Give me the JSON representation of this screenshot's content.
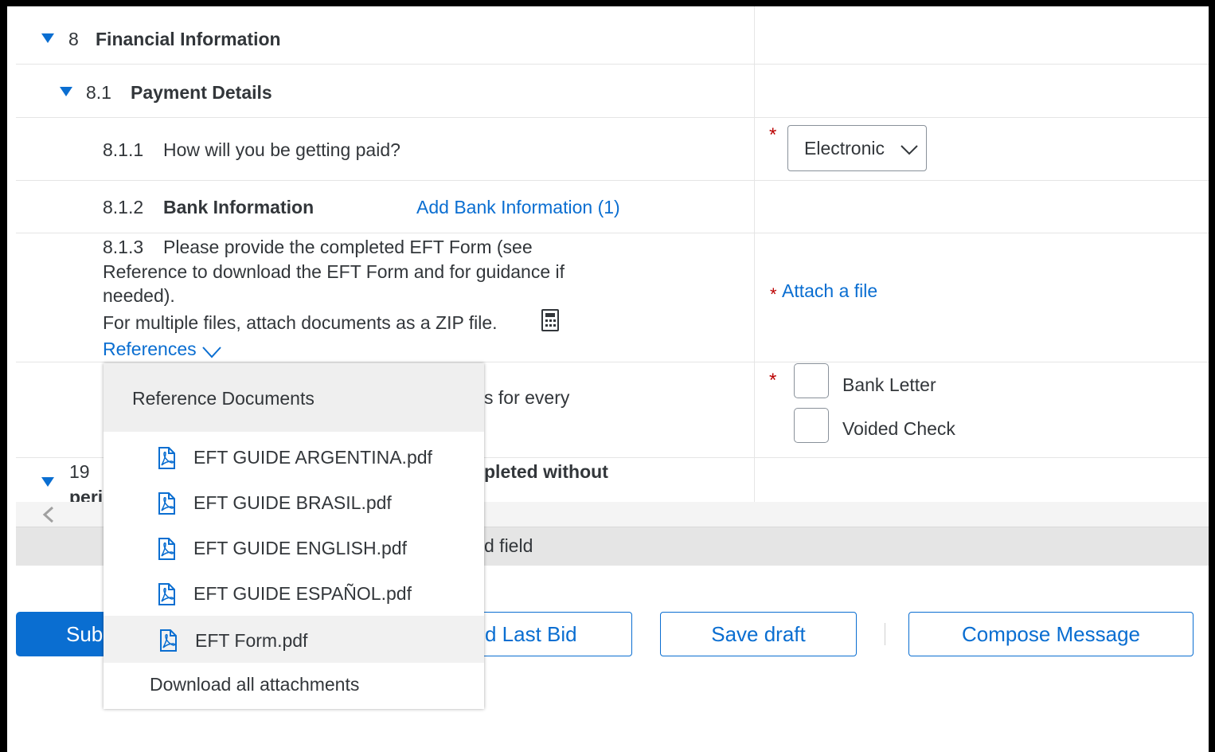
{
  "section_8": {
    "number": "8",
    "title": "Financial Information"
  },
  "section_8_1": {
    "number": "8.1",
    "title": "Payment Details"
  },
  "q_8_1_1": {
    "number": "8.1.1",
    "question": "How will you be getting paid?",
    "select_value": "Electronic"
  },
  "q_8_1_2": {
    "number": "8.1.2",
    "title": "Bank Information",
    "link": "Add Bank Information (1)"
  },
  "q_8_1_3": {
    "number": "8.1.3",
    "line1": "Please provide the completed EFT Form (see",
    "line2": "Reference to download the EFT Form and for guidance if",
    "line3": "needed).",
    "line4": "For multiple files, attach documents as a ZIP file.",
    "references_link": "References",
    "attach_link": "Attach a file"
  },
  "q_8_1_4": {
    "partial_text": "s for every",
    "options": [
      "Bank Letter",
      "Voided Check"
    ]
  },
  "section_19": {
    "number": "19",
    "partial_line1": "peri",
    "partial_line2": "pleted without"
  },
  "required_footer": "d field",
  "required_mark": "*",
  "popover": {
    "header": "Reference Documents",
    "items": [
      "EFT GUIDE ARGENTINA.pdf",
      "EFT GUIDE BRASIL.pdf",
      "EFT GUIDE ENGLISH.pdf",
      "EFT GUIDE ESPAÑOL.pdf",
      "EFT Form.pdf"
    ],
    "download_all": "Download all attachments"
  },
  "buttons": {
    "submit_partial": "Sub",
    "last_bid_partial": "d Last Bid",
    "save_draft": "Save draft",
    "compose": "Compose Message"
  },
  "colors": {
    "accent": "#0a6ed1",
    "required": "#bb0000",
    "text": "#32363a"
  }
}
